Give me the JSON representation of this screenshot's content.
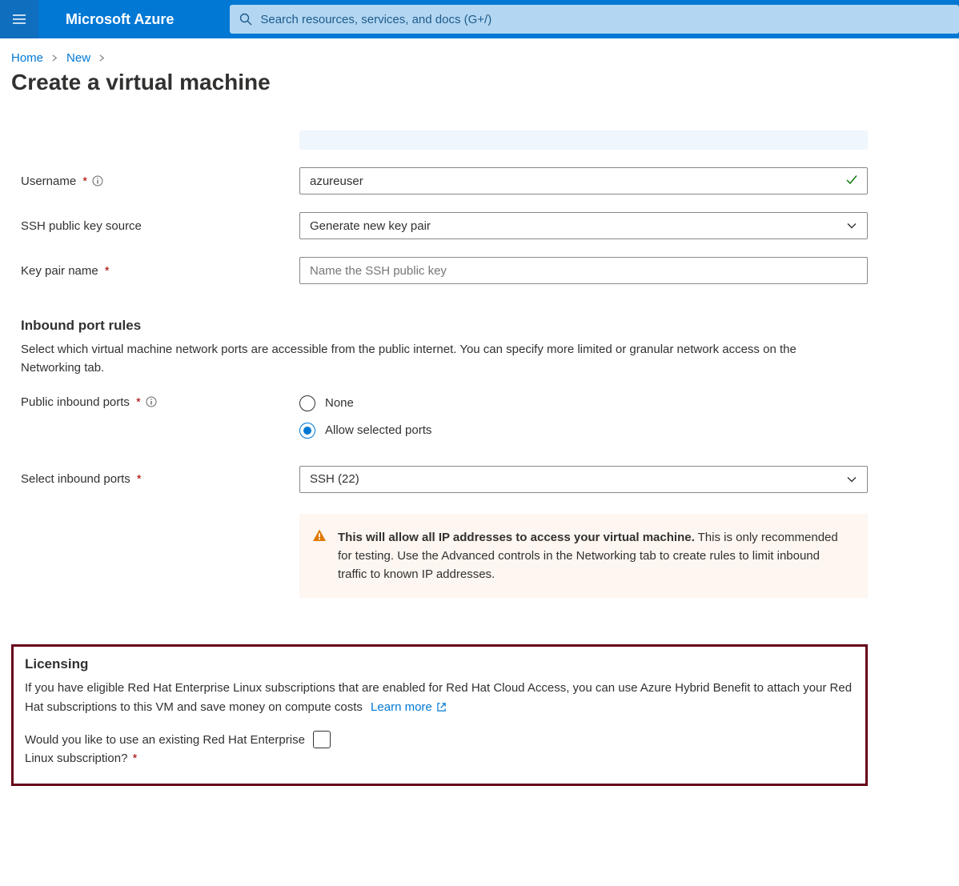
{
  "header": {
    "brand": "Microsoft Azure",
    "search_placeholder": "Search resources, services, and docs (G+/)"
  },
  "breadcrumb": {
    "items": [
      "Home",
      "New"
    ]
  },
  "page": {
    "title": "Create a virtual machine"
  },
  "form": {
    "username": {
      "label": "Username",
      "value": "azureuser"
    },
    "ssh_source": {
      "label": "SSH public key source",
      "value": "Generate new key pair"
    },
    "keypair": {
      "label": "Key pair name",
      "placeholder": "Name the SSH public key"
    }
  },
  "inbound": {
    "heading": "Inbound port rules",
    "description": "Select which virtual machine network ports are accessible from the public internet. You can specify more limited or granular network access on the Networking tab.",
    "public_inbound_label": "Public inbound ports",
    "radio_none": "None",
    "radio_allow": "Allow selected ports",
    "select_label": "Select inbound ports",
    "select_value": "SSH (22)",
    "warning_bold": "This will allow all IP addresses to access your virtual machine.",
    "warning_rest": "  This is only recommended for testing.  Use the Advanced controls in the Networking tab to create rules to limit inbound traffic to known IP addresses."
  },
  "licensing": {
    "heading": "Licensing",
    "description": "If you have eligible Red Hat Enterprise Linux subscriptions that are enabled for Red Hat Cloud Access, you can use Azure Hybrid Benefit to attach your Red Hat subscriptions to this VM and save money on compute costs",
    "learn_more": "Learn more",
    "question": "Would you like to use an existing Red Hat Enterprise Linux subscription?"
  }
}
